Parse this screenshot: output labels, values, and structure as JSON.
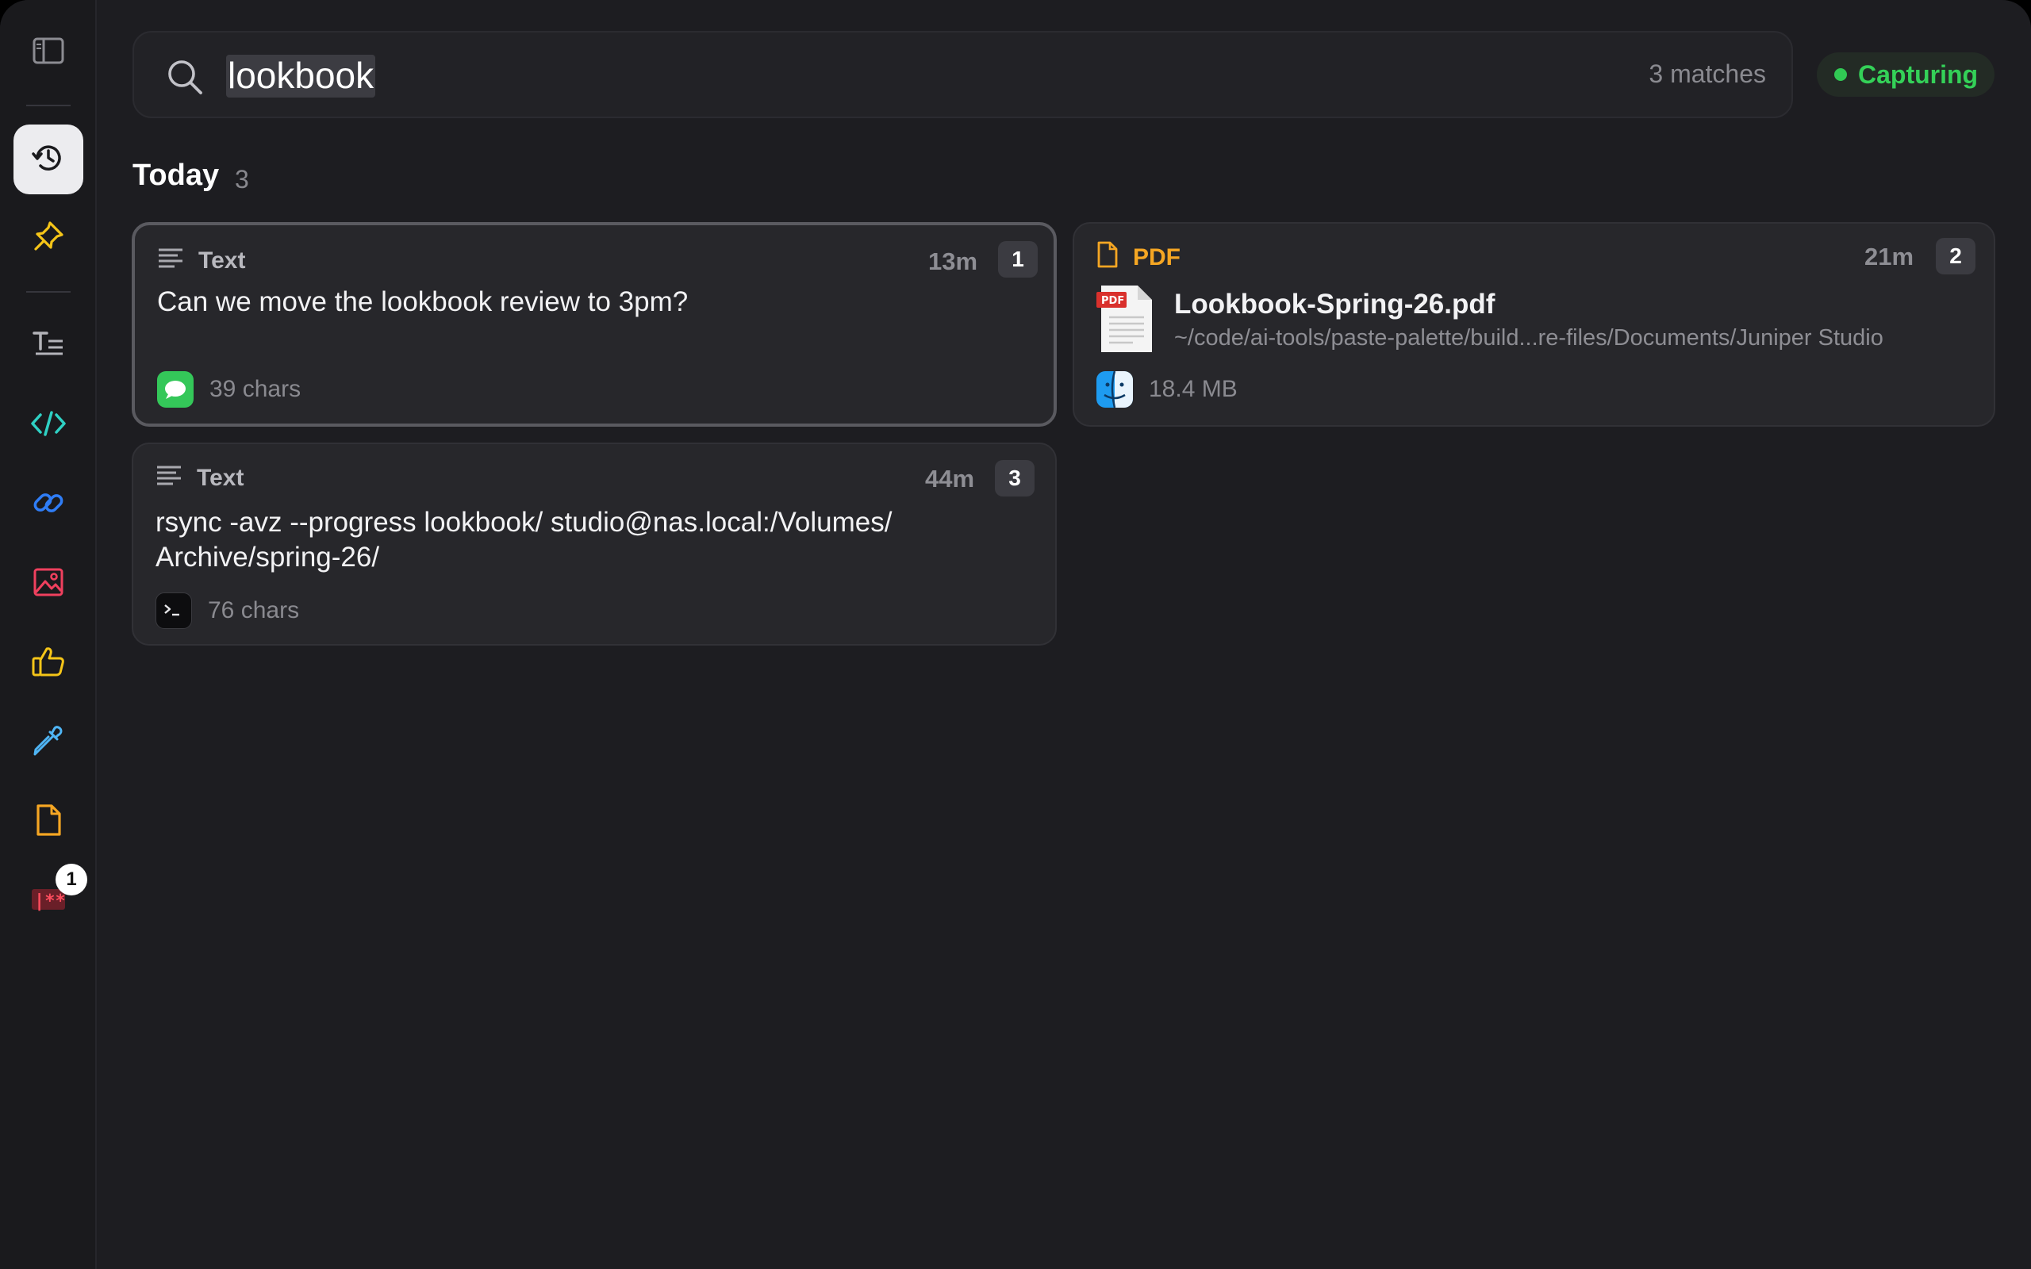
{
  "search": {
    "query": "lookbook",
    "match_count": "3 matches"
  },
  "status": {
    "label": "Capturing",
    "color": "#34d158"
  },
  "sidebar": {
    "items": [
      {
        "icon": "sidebar-toggle-icon"
      },
      {
        "icon": "history-icon",
        "active": true
      },
      {
        "icon": "pin-icon"
      },
      {
        "icon": "text-format-icon"
      },
      {
        "icon": "code-icon"
      },
      {
        "icon": "link-icon"
      },
      {
        "icon": "image-icon"
      },
      {
        "icon": "thumbs-up-icon"
      },
      {
        "icon": "eyedropper-icon"
      },
      {
        "icon": "file-icon"
      },
      {
        "icon": "password-icon",
        "badge": "1"
      }
    ]
  },
  "section": {
    "title": "Today",
    "count": "3"
  },
  "cards": [
    {
      "type": "Text",
      "time": "13m",
      "index": "1",
      "content": "Can we move the lookbook review to 3pm?",
      "meta": "39 chars",
      "app_icon": "messages-icon"
    },
    {
      "type": "PDF",
      "time": "21m",
      "index": "2",
      "file_name": "Lookbook-Spring-26.pdf",
      "file_path": "~/code/ai-tools/paste-palette/build...re-files/Documents/Juniper Studio",
      "file_badge": "PDF",
      "meta": "18.4 MB",
      "app_icon": "finder-icon"
    },
    {
      "type": "Text",
      "time": "44m",
      "index": "3",
      "content_line1": "rsync -avz --progress lookbook/ studio@nas.local:/Volumes/",
      "content_line2": "Archive/spring-26/",
      "meta": "76 chars",
      "app_icon": "terminal-icon"
    }
  ]
}
